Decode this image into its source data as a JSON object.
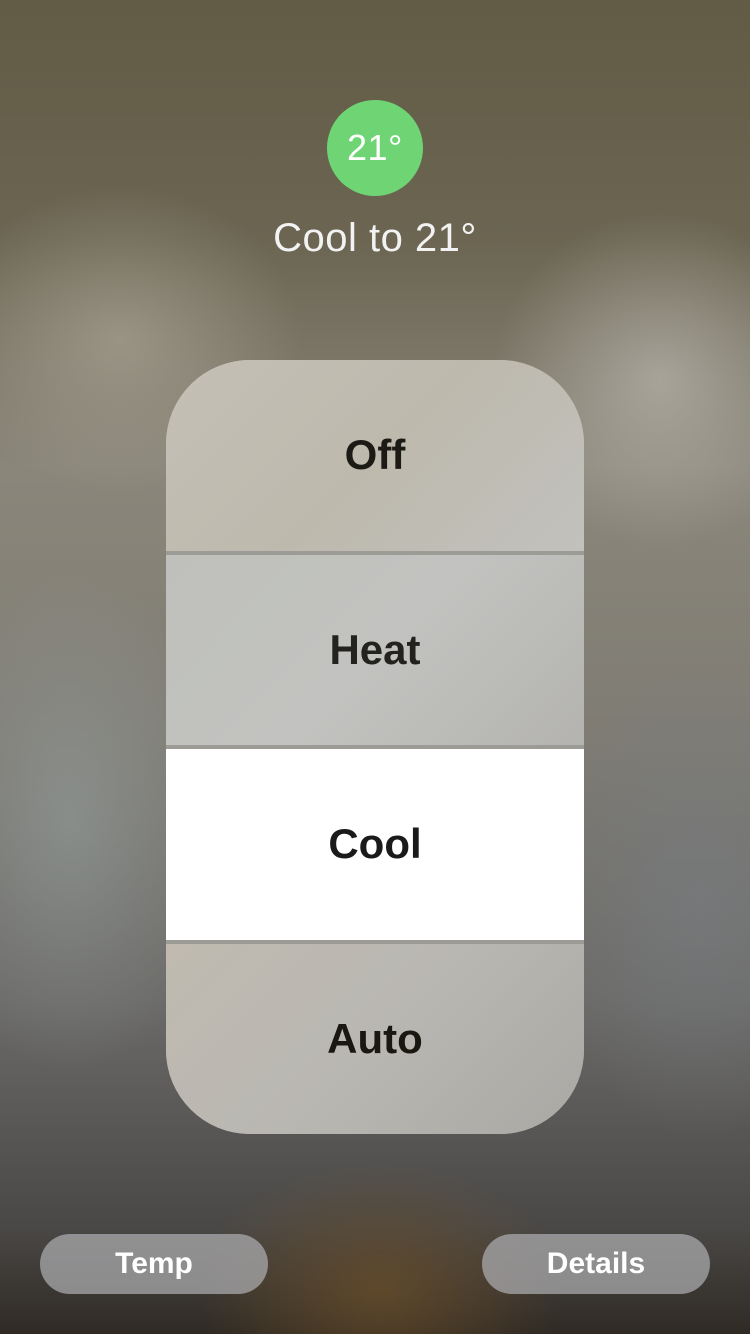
{
  "thermostat": {
    "current_setting": "21°",
    "status": "Cool to 21°",
    "accent_color": "#6fd574"
  },
  "modes": {
    "selected": "Cool",
    "items": [
      {
        "label": "Off"
      },
      {
        "label": "Heat"
      },
      {
        "label": "Cool"
      },
      {
        "label": "Auto"
      }
    ]
  },
  "bottom_bar": {
    "temp_label": "Temp",
    "details_label": "Details"
  }
}
